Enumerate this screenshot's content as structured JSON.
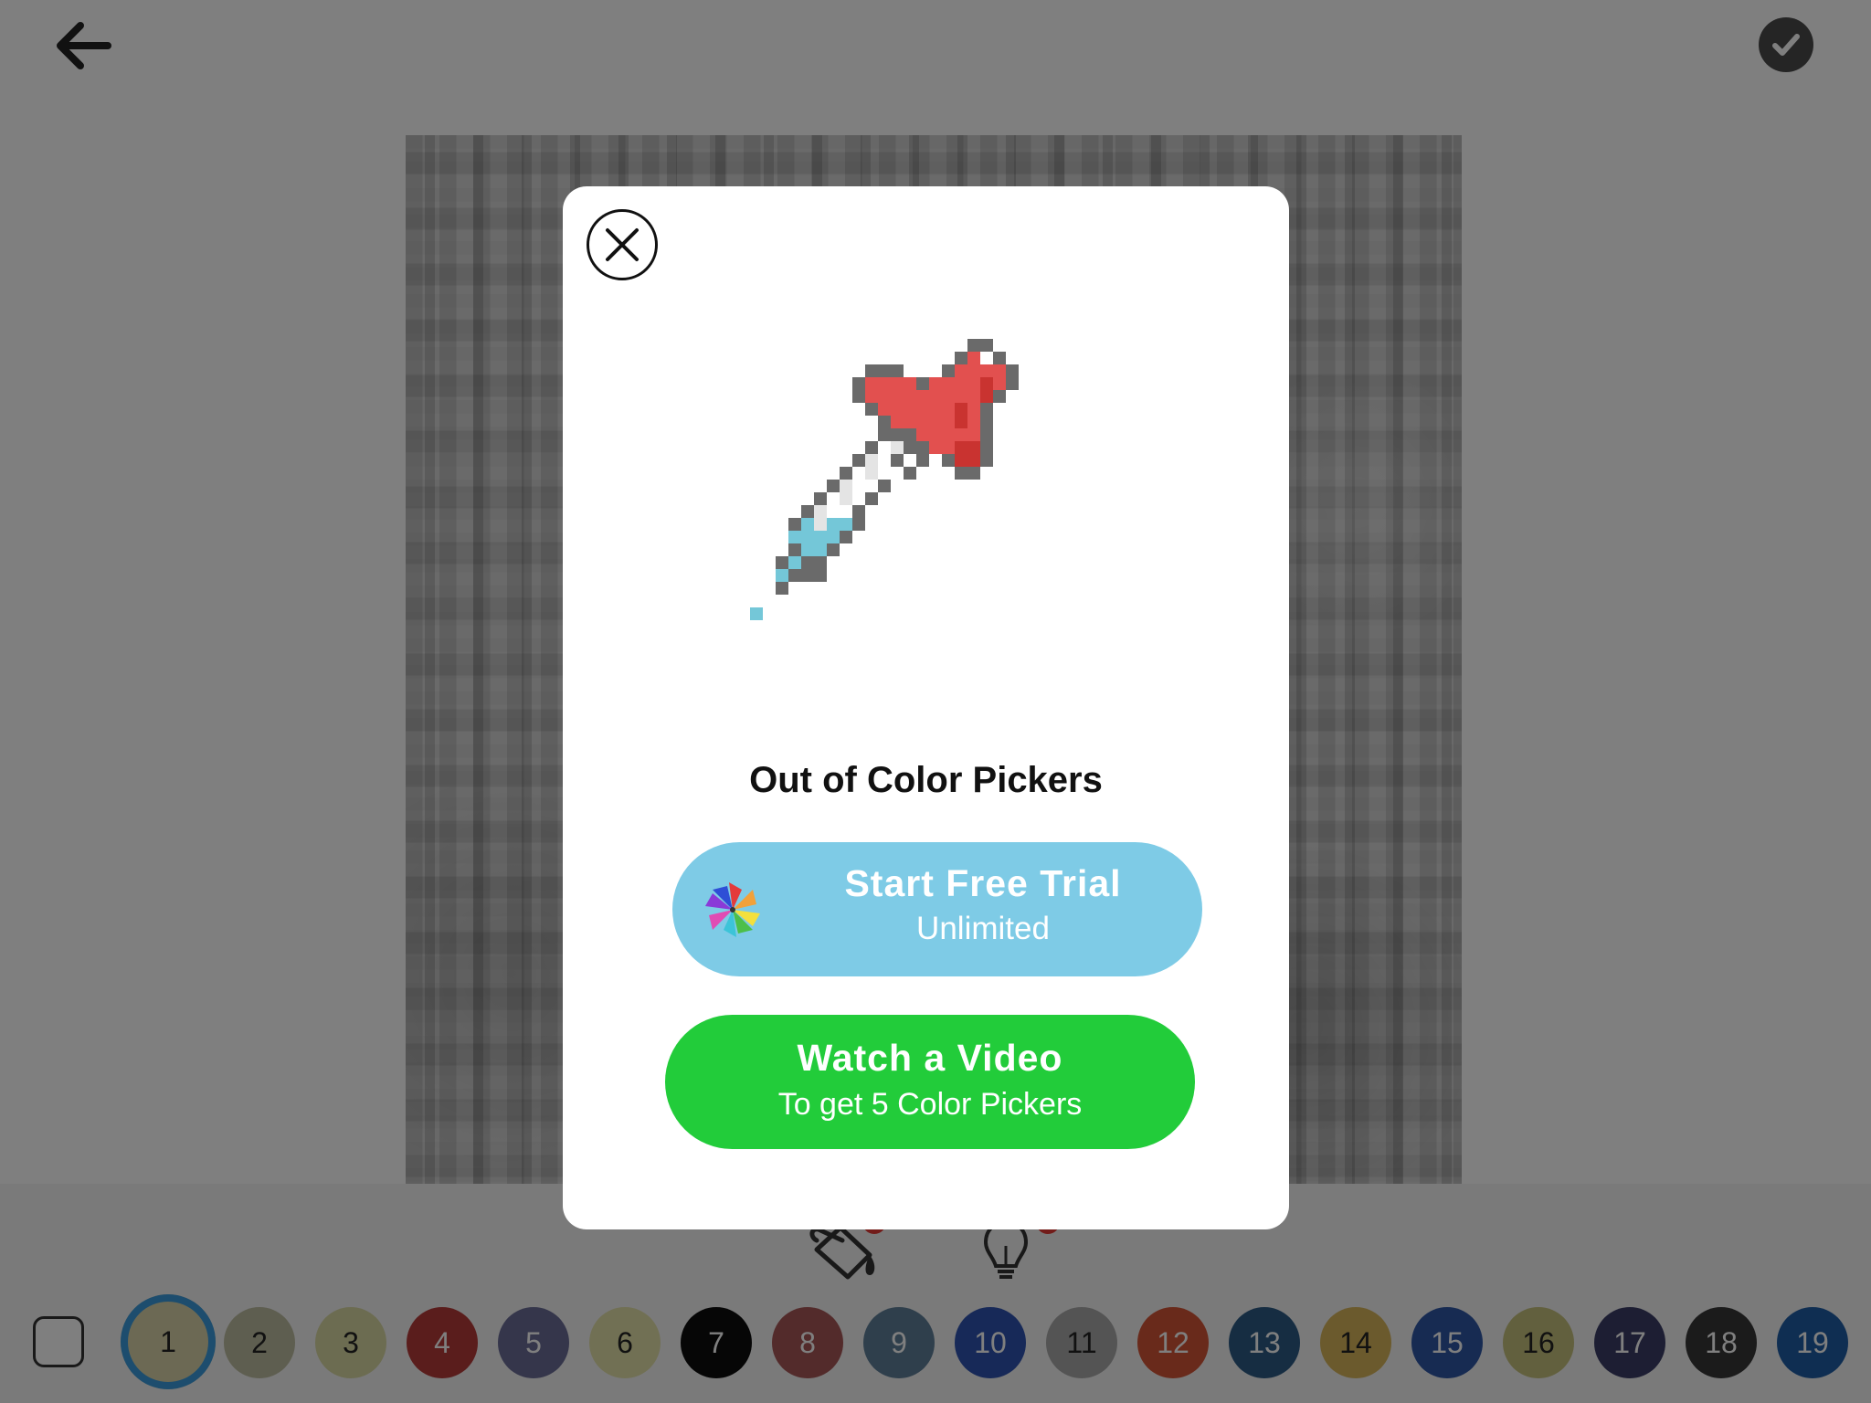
{
  "toolbar": {
    "back_icon": "arrow-left-icon",
    "done_icon": "checkmark-icon"
  },
  "tools": {
    "brush_icon": "paint-bucket-icon",
    "hint_icon": "lightbulb-icon"
  },
  "palette": {
    "selected": "1",
    "swatches": [
      {
        "label": "1",
        "color": "#d8d2a8"
      },
      {
        "label": "2",
        "color": "#bcbca0"
      },
      {
        "label": "3",
        "color": "#d9d8a3"
      },
      {
        "label": "4",
        "color": "#b43a38"
      },
      {
        "label": "5",
        "color": "#6a6d96"
      },
      {
        "label": "6",
        "color": "#e3e1a9"
      },
      {
        "label": "7",
        "color": "#0d0d0d"
      },
      {
        "label": "8",
        "color": "#a65656"
      },
      {
        "label": "9",
        "color": "#5f7f98"
      },
      {
        "label": "10",
        "color": "#2f52b0"
      },
      {
        "label": "11",
        "color": "#a8a8a8"
      },
      {
        "label": "12",
        "color": "#d35436"
      },
      {
        "label": "13",
        "color": "#2d5b84"
      },
      {
        "label": "14",
        "color": "#d6b55b"
      },
      {
        "label": "15",
        "color": "#2e56a5"
      },
      {
        "label": "16",
        "color": "#c4c07d"
      },
      {
        "label": "17",
        "color": "#3a3d66"
      },
      {
        "label": "18",
        "color": "#363636"
      },
      {
        "label": "19",
        "color": "#1f5da4"
      }
    ]
  },
  "modal": {
    "close_icon": "close-icon",
    "illustration": "color-picker-dropper-icon",
    "title": "Out of Color Pickers",
    "trial": {
      "icon": "pinwheel-icon",
      "label": "Start Free Trial",
      "sub": "Unlimited"
    },
    "video": {
      "label": "Watch a Video",
      "sub": "To get 5 Color Pickers"
    }
  },
  "colors": {
    "trial_button": "#7ecbe6",
    "video_button": "#22cc3a",
    "heart": "#e2504f",
    "dropper_liquid": "#74c7d8",
    "outline": "#6a6a6a"
  }
}
